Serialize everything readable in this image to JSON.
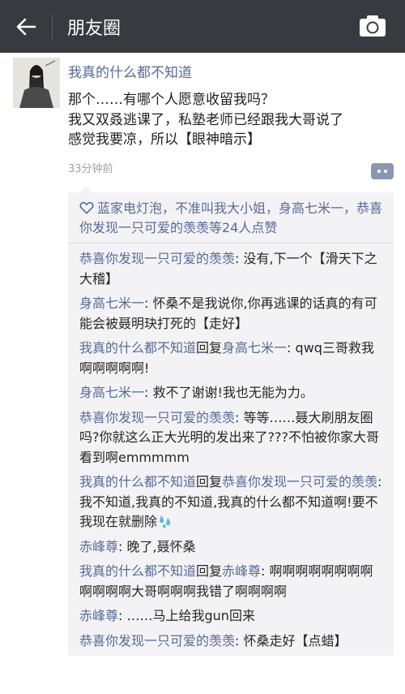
{
  "header": {
    "title": "朋友圈"
  },
  "post": {
    "author": "我真的什么都不知道",
    "lines": [
      "那个……有哪个人愿意收留我吗？",
      "我又双叒逃课了，私塾老师已经跟我大哥说了",
      "感觉我要凉，所以【眼神暗示】"
    ],
    "time": "33分钟前"
  },
  "likes": {
    "text": "蓝家电灯泡，不准叫我大小姐，身高七米一，恭喜你发现一只可爱的羡羡等24人点赞"
  },
  "comments": [
    {
      "name": "恭喜你发现一只可爱的羡羡",
      "text": "没有,下一个【滑天下之大稽】"
    },
    {
      "name": "身高七米一",
      "text": "怀桑不是我说你,你再逃课的话真的有可能会被聂明玦打死的【走好】"
    },
    {
      "name": "我真的什么都不知道",
      "reply_word": "回复",
      "reply_to": "身高七米一",
      "text": "qwq三哥救我啊啊啊啊啊!"
    },
    {
      "name": "身高七米一",
      "text": "救不了谢谢!我也无能为力。"
    },
    {
      "name": "恭喜你发现一只可爱的羡羡",
      "text": "等等……聂大刷朋友圈吗?你就这么正大光明的发出来了???不怕被你家大哥看到啊emmmmm"
    },
    {
      "name": "我真的什么都不知道",
      "reply_word": "回复",
      "reply_to": "恭喜你发现一只可爱的羡羡",
      "text": "我不知道,我真的不知道,我真的什么都不知道啊!要不我现在就删除"
    },
    {
      "name": "赤峰尊",
      "text": "晚了,聂怀桑"
    },
    {
      "name": "我真的什么都不知道",
      "reply_word": "回复",
      "reply_to": "赤峰尊",
      "text": "啊啊啊啊啊啊啊啊啊啊啊啊大哥啊啊啊我错了啊啊啊啊"
    },
    {
      "name": "赤峰尊",
      "text": "……马上给我gun回来"
    },
    {
      "name": "恭喜你发现一只可爱的羡羡",
      "text": "怀桑走好【点蜡】"
    }
  ],
  "icons": {
    "back": "back-arrow-icon",
    "camera": "camera-icon",
    "comment": "comment-dots-icon",
    "like": "heart-icon",
    "emoji": "sweat-drops-emoji"
  },
  "colors": {
    "topbar": "#393a3f",
    "link": "#576b95",
    "panel": "#f3f3f5"
  }
}
